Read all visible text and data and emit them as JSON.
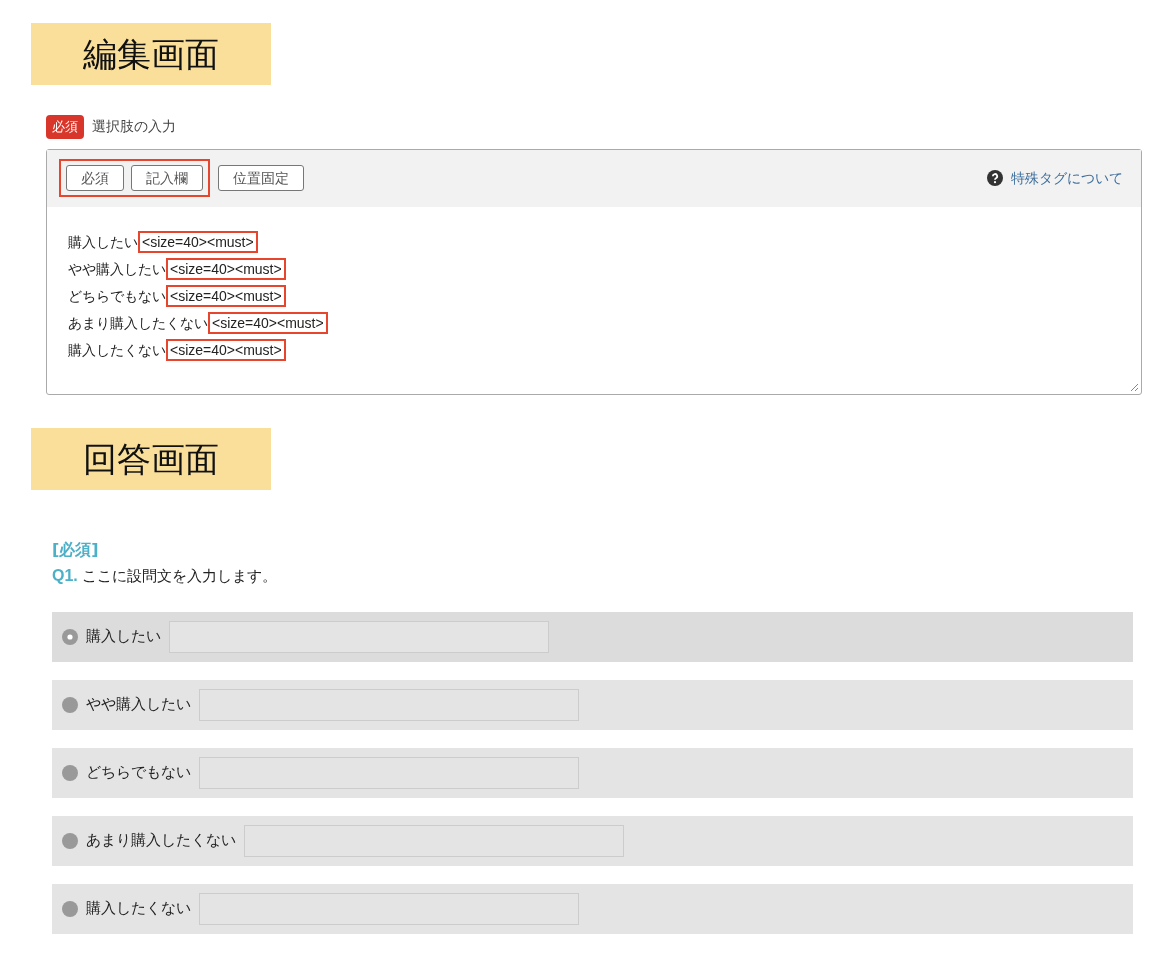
{
  "editor_section": {
    "title": "編集画面",
    "field": {
      "badge": "必須",
      "label": "選択肢の入力"
    },
    "toolbar": {
      "buttons": [
        {
          "label": "必須",
          "highlighted": true
        },
        {
          "label": "記入欄",
          "highlighted": true
        },
        {
          "label": "位置固定",
          "highlighted": false
        }
      ],
      "help_link": "特殊タグについて"
    },
    "lines": [
      {
        "text": "購入したい",
        "tag": "<size=40><must>"
      },
      {
        "text": "やや購入したい",
        "tag": "<size=40><must>"
      },
      {
        "text": "どちらでもない",
        "tag": "<size=40><must>"
      },
      {
        "text": "あまり購入したくない",
        "tag": "<size=40><must>"
      },
      {
        "text": "購入したくない",
        "tag": "<size=40><must>"
      }
    ]
  },
  "answer_section": {
    "title": "回答画面",
    "required_label": "[必須]",
    "question": {
      "number": "Q1.",
      "text": "ここに設問文を入力します。"
    },
    "options": [
      {
        "label": "購入したい",
        "selected": true
      },
      {
        "label": "やや購入したい",
        "selected": false
      },
      {
        "label": "どちらでもない",
        "selected": false
      },
      {
        "label": "あまり購入したくない",
        "selected": false
      },
      {
        "label": "購入したくない",
        "selected": false
      }
    ]
  }
}
